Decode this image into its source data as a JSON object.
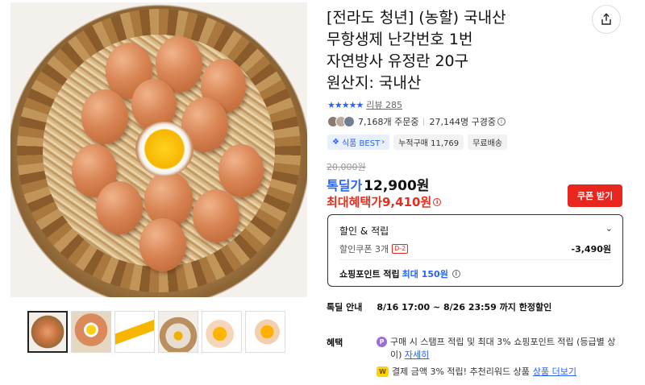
{
  "product": {
    "title_lines": [
      "[전라도 청년] (농할) 국내산",
      "무항생제 난각번호 1번",
      "자연방사 유정란 20구",
      "원산지: 국내산"
    ],
    "rating_stars": "★★★★★",
    "review_label": "리뷰 285",
    "orders": "7,168개 주문중",
    "reviewers": "27,144명 구경중",
    "tags": [
      "식품 BEST",
      "누적구매 11,769",
      "무료배송"
    ],
    "original_price": "20,000원",
    "deal_label": "톡딜가",
    "deal_price": "12,900원",
    "max_benefit": "최대혜택가9,410원",
    "coupon_button": "쿠폰 받기"
  },
  "benefit_box": {
    "heading": "할인 & 적립",
    "coupon_label": "할인쿠폰 3개",
    "coupon_badge": "D-2",
    "coupon_amount": "-3,490원",
    "point_label": "쇼핑포인트 적립",
    "point_value": "최대 150원"
  },
  "notice": {
    "label": "톡딜 안내",
    "text": "8/16 17:00 ~ 8/26 23:59 까지 한정할인"
  },
  "benefits": {
    "label": "혜택",
    "item1_icon": "P",
    "item1_text": "구매 시 스탬프 적립 및 최대 3% 쇼핑포인트 적립 (등급별 상이)",
    "item1_link": "자세히",
    "item2_icon": "W",
    "item2_text": "결제 금액 3% 적립! 추천리워드 상품",
    "item2_link": "상품 더보기"
  },
  "thumbnails": [
    "egg-nest",
    "egg-yolk",
    "egg-chopsticks",
    "egg-basket",
    "yolk-hand",
    "yolk-pinch"
  ],
  "colors": {
    "accent_blue": "#2962ff",
    "accent_red": "#e8261e"
  }
}
